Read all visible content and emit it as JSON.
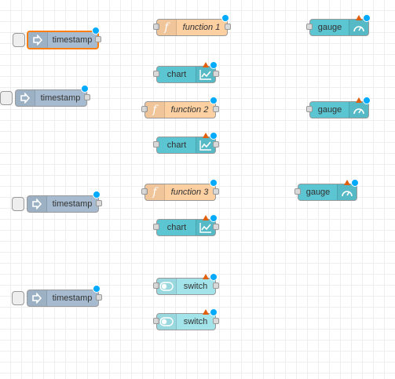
{
  "workspace": {
    "colors": {
      "grid": "#eeeeee",
      "inject": "#a6bbcf",
      "function": "#fdd0a2",
      "dashboard": "#5bc5d1",
      "switch": "#a2e4ea",
      "selected_outline": "#ff7f0e",
      "changed_dot": "#00aaff",
      "error_triangle": "#e0600f"
    }
  },
  "nodes": {
    "inject1": {
      "label": "timestamp",
      "icon": "arrow-in-icon",
      "selected": true
    },
    "inject2": {
      "label": "timestamp",
      "icon": "arrow-in-icon"
    },
    "inject3": {
      "label": "timestamp",
      "icon": "arrow-in-icon"
    },
    "inject4": {
      "label": "timestamp",
      "icon": "arrow-in-icon"
    },
    "function1": {
      "label": "function 1",
      "icon": "function-icon"
    },
    "function2": {
      "label": "function 2",
      "icon": "function-icon"
    },
    "function3": {
      "label": "function 3",
      "icon": "function-icon"
    },
    "chart1": {
      "label": "chart",
      "icon": "chart-icon"
    },
    "chart2": {
      "label": "chart",
      "icon": "chart-icon"
    },
    "chart3": {
      "label": "chart",
      "icon": "chart-icon"
    },
    "gauge1": {
      "label": "gauge",
      "icon": "gauge-icon"
    },
    "gauge2": {
      "label": "gauge",
      "icon": "gauge-icon"
    },
    "gauge3": {
      "label": "gauge",
      "icon": "gauge-icon"
    },
    "switch1": {
      "label": "switch",
      "icon": "toggle-icon"
    },
    "switch2": {
      "label": "switch",
      "icon": "toggle-icon"
    }
  }
}
